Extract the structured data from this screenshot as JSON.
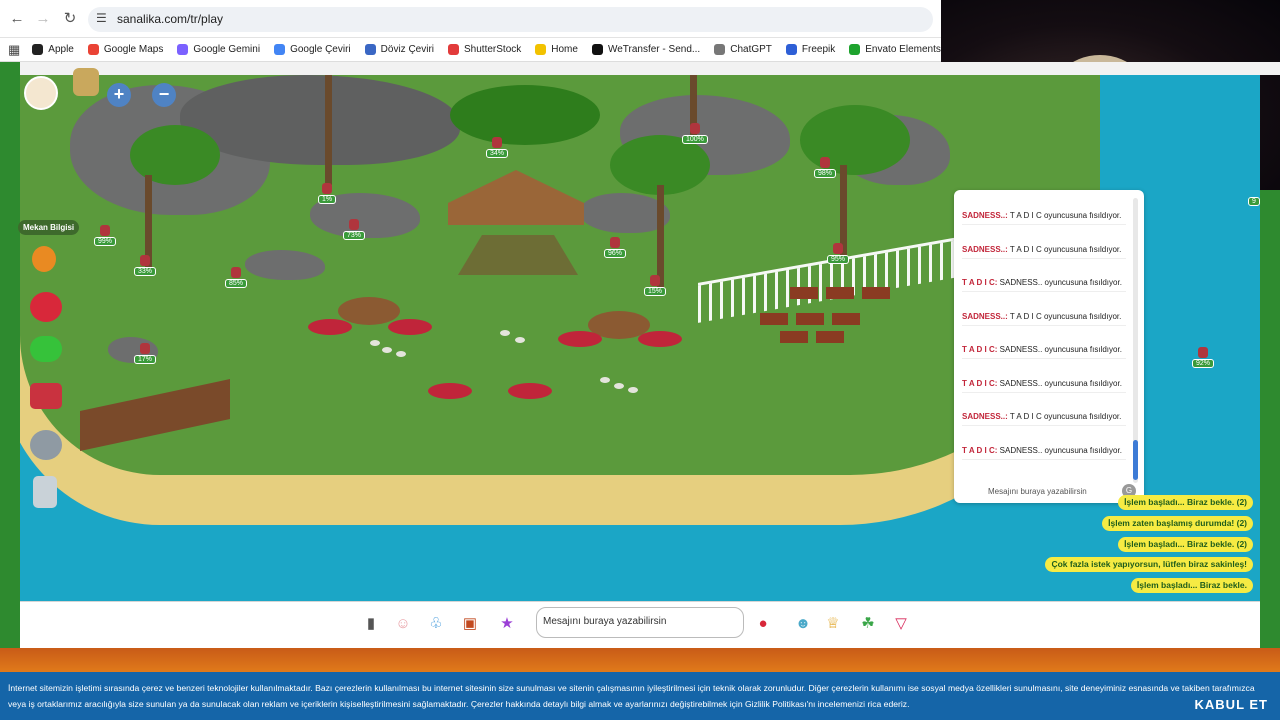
{
  "browser": {
    "url": "sanalika.com/tr/play",
    "bookmarks": [
      "Apple",
      "Google Maps",
      "Google Gemini",
      "Google Çeviri",
      "Döviz Çeviri",
      "ShutterStock",
      "Home",
      "WeTransfer - Send...",
      "ChatGPT",
      "Freepik",
      "Envato Elements:..."
    ],
    "bookmark_colors": [
      "#222222",
      "#ea4335",
      "#7b61ff",
      "#4285f4",
      "#3a67c4",
      "#e23b3b",
      "#f2c200",
      "#111111",
      "#777777",
      "#2e5fd6",
      "#1ea32e"
    ]
  },
  "game": {
    "tooltip": "Mekan Bilgisi",
    "locks": [
      {
        "pct": "34%"
      },
      {
        "pct": "100%"
      },
      {
        "pct": "98%"
      },
      {
        "pct": "1%"
      },
      {
        "pct": "73%"
      },
      {
        "pct": "99%"
      },
      {
        "pct": "33%"
      },
      {
        "pct": "85%"
      },
      {
        "pct": "96%"
      },
      {
        "pct": "15%"
      },
      {
        "pct": "95%"
      },
      {
        "pct": "17%"
      },
      {
        "pct": "92%"
      }
    ],
    "right_edge_lock": "9"
  },
  "chat": {
    "messages": [
      {
        "who": "SADNESS..:",
        "text": "T A D I C oyuncusuna fısıldıyor."
      },
      {
        "who": "SADNESS..:",
        "text": "T A D I C oyuncusuna fısıldıyor."
      },
      {
        "who": "T A D I C:",
        "text": "SADNESS.. oyuncusuna fısıldıyor."
      },
      {
        "who": "SADNESS..:",
        "text": "T A D I C oyuncusuna fısıldıyor."
      },
      {
        "who": "T A D I C:",
        "text": "SADNESS.. oyuncusuna fısıldıyor."
      },
      {
        "who": "T A D I C:",
        "text": "SADNESS.. oyuncusuna fısıldıyor."
      },
      {
        "who": "SADNESS..:",
        "text": "T A D I C oyuncusuna fısıldıyor."
      },
      {
        "who": "T A D I C:",
        "text": "SADNESS.. oyuncusuna fısıldıyor."
      }
    ],
    "placeholder": "Mesajını buraya yazabilirsin",
    "send_glyph": "G"
  },
  "notifications": [
    "İşlem başladı... Biraz bekle. (2)",
    "İşlem zaten başlamış durumda! (2)",
    "İşlem başladı... Biraz bekle. (2)",
    "Çok fazla istek yapıyorsun, lütfen biraz sakinleş!",
    "İşlem başladı... Biraz bekle."
  ],
  "bottom_bar": {
    "chat_placeholder": "Mesajını buraya yazabilirsin",
    "icons": [
      "phone-icon",
      "friends-icon",
      "clothes-icon",
      "chest-icon",
      "dance-icon",
      "emote-chat-icon",
      "pet-icon",
      "trophy-icon",
      "island-icon",
      "shop-icon"
    ]
  },
  "cookie": {
    "text": "İnternet sitemizin işletimi sırasında çerez ve benzeri teknolojiler kullanılmaktadır. Bazı çerezlerin kullanılması bu internet sitesinin size sunulması ve sitenin çalışmasının iyileştirilmesi için teknik olarak zorunludur. Diğer çerezlerin kullanımı ise sosyal medya özellikleri sunulmasını, site deneyiminiz esnasında ve takiben tarafımızca veya iş ortaklarımız aracılığıyla size sunulan ya da sunulacak olan reklam ve içeriklerin kişiselleştirilmesini sağlamaktadır. Çerezler hakkında detaylı bilgi almak ve ayarlarınızı değiştirebilmek için Gizlilik Politikası'nı incelemenizi rica ederiz.",
    "accept": "KABUL ET"
  }
}
